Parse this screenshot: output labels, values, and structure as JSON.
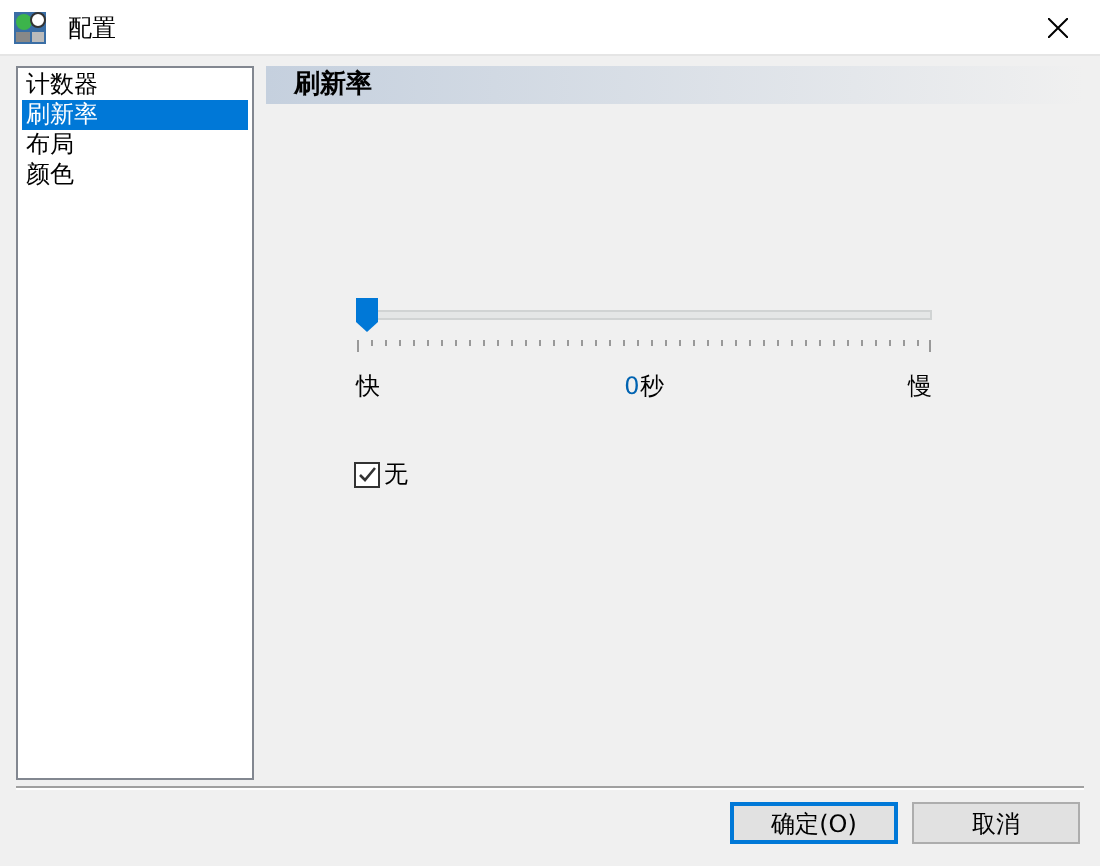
{
  "window": {
    "title": "配置"
  },
  "sidebar": {
    "items": [
      {
        "label": "计数器",
        "selected": false
      },
      {
        "label": "刷新率",
        "selected": true
      },
      {
        "label": "布局",
        "selected": false
      },
      {
        "label": "颜色",
        "selected": false
      }
    ]
  },
  "panel": {
    "title": "刷新率",
    "slider": {
      "level": 0,
      "min_label": "快",
      "value": "0",
      "unit": "秒",
      "max_label": "慢"
    },
    "checkbox": {
      "label": "无",
      "checked": true
    }
  },
  "buttons": [
    {
      "label": "确定(O)",
      "default": true
    },
    {
      "label": "取消",
      "default": false
    }
  ]
}
